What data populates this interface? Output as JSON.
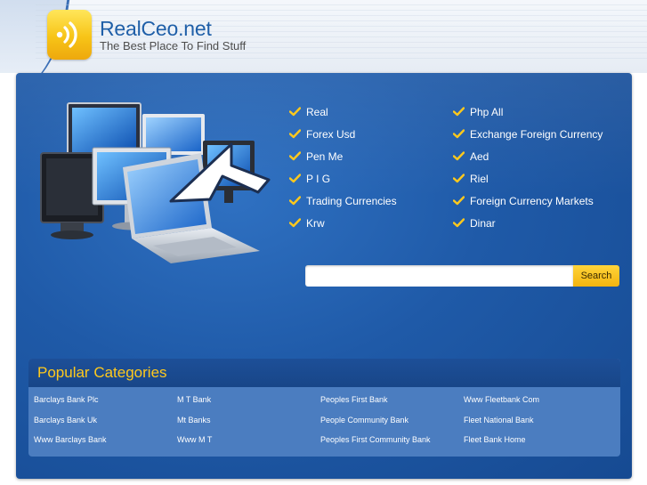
{
  "header": {
    "site_title": "RealCeo.net",
    "tagline": "The Best Place To Find Stuff",
    "logo_icon": "signal-waves-icon"
  },
  "colors": {
    "panel_blue": "#1f5aa8",
    "accent_yellow": "#ffc91c",
    "title_blue": "#1f5fa8"
  },
  "links_left": [
    {
      "label": "Real"
    },
    {
      "label": "Forex Usd"
    },
    {
      "label": "Pen Me"
    },
    {
      "label": "P I G"
    },
    {
      "label": "Trading Currencies"
    },
    {
      "label": "Krw"
    }
  ],
  "links_right": [
    {
      "label": "Php All"
    },
    {
      "label": "Exchange Foreign Currency"
    },
    {
      "label": "Aed"
    },
    {
      "label": "Riel"
    },
    {
      "label": "Foreign Currency Markets"
    },
    {
      "label": "Dinar"
    }
  ],
  "search": {
    "value": "",
    "placeholder": "",
    "button_label": "Search"
  },
  "popular": {
    "title": "Popular Categories",
    "columns": [
      [
        "Barclays Bank Plc",
        "Barclays Bank Uk",
        "Www Barclays Bank"
      ],
      [
        "M T Bank",
        "Mt Banks",
        "Www M T"
      ],
      [
        "Peoples First Bank",
        "People Community Bank",
        "Peoples First Community Bank"
      ],
      [
        "Www Fleetbank Com",
        "Fleet National Bank",
        "Fleet Bank Home"
      ]
    ]
  }
}
